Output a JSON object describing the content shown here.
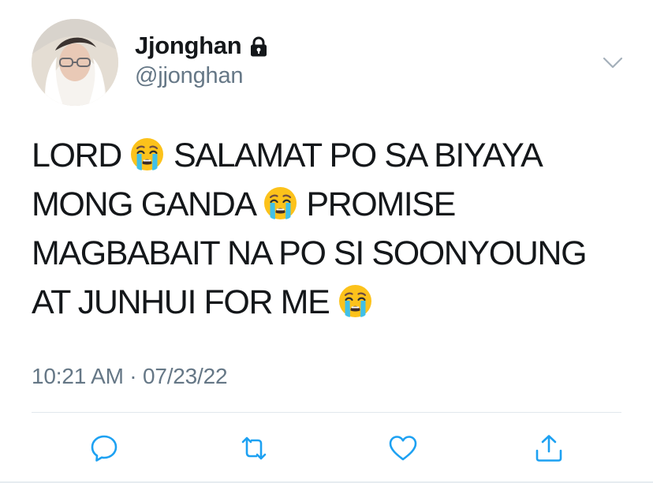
{
  "author": {
    "display_name": "Jjonghan",
    "handle": "@jjonghan",
    "protected_icon": "lock-icon"
  },
  "tweet": {
    "lines": [
      "LORD 😭 SALAMAT PO SA BIYAYA",
      "MONG GANDA 😭 PROMISE",
      "MAGBABAIT NA PO SI SOONYOUNG",
      "AT JUNHUI FOR ME 😭"
    ],
    "timestamp": "10:21 AM · 07/23/22"
  },
  "actions": [
    "reply-icon",
    "retweet-icon",
    "like-icon",
    "share-icon"
  ],
  "colors": {
    "text": "#14171a",
    "secondary": "#657786",
    "icon": "#1da1f2",
    "divider": "#e1e8ed"
  }
}
